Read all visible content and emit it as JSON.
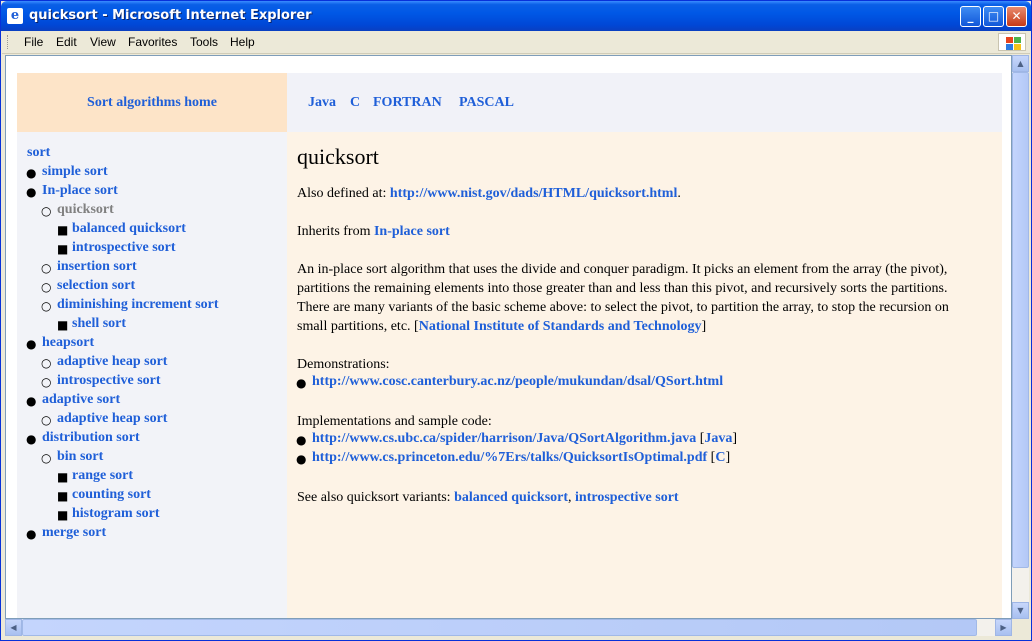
{
  "window": {
    "title": "quicksort - Microsoft Internet Explorer",
    "icon": "ie-icon"
  },
  "menu": [
    "File",
    "Edit",
    "View",
    "Favorites",
    "Tools",
    "Help"
  ],
  "header": {
    "home_link": "Sort algorithms home",
    "languages": [
      "Java",
      "C",
      "FORTRAN",
      "PASCAL"
    ]
  },
  "sidebar": {
    "root": "sort",
    "items": [
      {
        "label": "simple sort",
        "level": 1
      },
      {
        "label": "In-place sort",
        "level": 1
      },
      {
        "label": "quicksort",
        "level": 2,
        "current": true
      },
      {
        "label": "balanced quicksort",
        "level": 3
      },
      {
        "label": "introspective sort",
        "level": 3
      },
      {
        "label": "insertion sort",
        "level": 2
      },
      {
        "label": "selection sort",
        "level": 2
      },
      {
        "label": "diminishing increment sort",
        "level": 2
      },
      {
        "label": "shell sort",
        "level": 3
      },
      {
        "label": "heapsort",
        "level": 1
      },
      {
        "label": "adaptive heap sort",
        "level": 2
      },
      {
        "label": "introspective sort",
        "level": 2
      },
      {
        "label": "adaptive sort",
        "level": 1
      },
      {
        "label": "adaptive heap sort",
        "level": 2
      },
      {
        "label": "distribution sort",
        "level": 1
      },
      {
        "label": "bin sort",
        "level": 2
      },
      {
        "label": "range sort",
        "level": 3
      },
      {
        "label": "counting sort",
        "level": 3
      },
      {
        "label": "histogram sort",
        "level": 3
      },
      {
        "label": "merge sort",
        "level": 1
      }
    ]
  },
  "content": {
    "title": "quicksort",
    "also_defined_prefix": "Also defined at: ",
    "also_defined_link": "http://www.nist.gov/dads/HTML/quicksort.html",
    "also_defined_suffix": ".",
    "inherits_prefix": "Inherits from ",
    "inherits_link": "In-place sort",
    "desc_lines": [
      "An in-place sort algorithm that uses the divide and conquer paradigm. It picks an element from the array (the pivot),",
      "partitions the remaining elements into those greater than and less than this pivot, and recursively sorts the partitions.",
      "There are many variants of the basic scheme above: to select the pivot, to partition the array, to stop the recursion on",
      "small partitions, etc. "
    ],
    "desc_source_link": "National Institute of Standards and Technology",
    "demos_label": "Demonstrations:",
    "demos": [
      "http://www.cosc.canterbury.ac.nz/people/mukundan/dsal/QSort.html"
    ],
    "impl_label": "Implementations and sample code:",
    "impls": [
      {
        "url": "http://www.cs.ubc.ca/spider/harrison/Java/QSortAlgorithm.java",
        "lang": "Java"
      },
      {
        "url": "http://www.cs.princeton.edu/%7Ers/talks/QuicksortIsOptimal.pdf",
        "lang": "C"
      }
    ],
    "see_also_prefix": "See also quicksort variants: ",
    "see_also": [
      "balanced quicksort",
      "introspective sort"
    ]
  }
}
